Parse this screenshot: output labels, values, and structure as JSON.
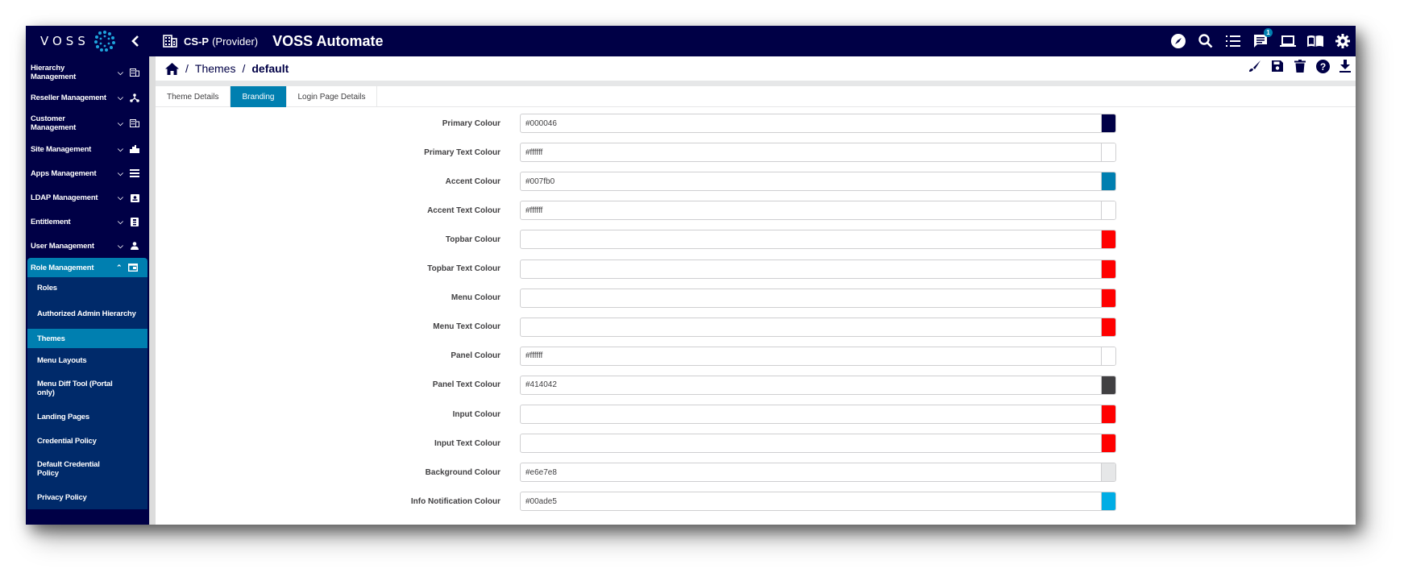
{
  "topbar": {
    "logo_text": "VOSS",
    "tenant_name": "CS-P",
    "tenant_role": "(Provider)",
    "app_title": "VOSS Automate",
    "notification_count": "1",
    "icons": [
      "compass-icon",
      "search-icon",
      "list-icon",
      "chat-icon",
      "laptop-icon",
      "book-icon",
      "gear-icon"
    ]
  },
  "sidebar": {
    "items": [
      {
        "label": "Hierarchy Management",
        "icon": "building-icon"
      },
      {
        "label": "Reseller Management",
        "icon": "hierarchy-icon"
      },
      {
        "label": "Customer Management",
        "icon": "building-icon"
      },
      {
        "label": "Site Management",
        "icon": "site-icon"
      },
      {
        "label": "Apps Management",
        "icon": "list-icon"
      },
      {
        "label": "LDAP Management",
        "icon": "contact-card-icon"
      },
      {
        "label": "Entitlement",
        "icon": "id-card-icon"
      },
      {
        "label": "User Management",
        "icon": "user-icon"
      },
      {
        "label": "Role Management",
        "icon": "window-icon"
      }
    ],
    "submenu": [
      {
        "label": "Roles"
      },
      {
        "label": "Authorized Admin Hierarchy"
      },
      {
        "label": "Themes"
      },
      {
        "label": "Menu Layouts"
      },
      {
        "label": "Menu Diff Tool (Portal only)"
      },
      {
        "label": "Landing Pages"
      },
      {
        "label": "Credential Policy"
      },
      {
        "label": "Default Credential Policy"
      },
      {
        "label": "Privacy Policy"
      }
    ]
  },
  "breadcrumb": {
    "section": "Themes",
    "current": "default"
  },
  "actions": [
    "brush-icon",
    "save-icon",
    "delete-icon",
    "help-icon",
    "download-icon"
  ],
  "tabs": [
    {
      "label": "Theme Details",
      "active": false
    },
    {
      "label": "Branding",
      "active": true
    },
    {
      "label": "Login Page Details",
      "active": false
    }
  ],
  "fields": [
    {
      "label": "Primary Colour",
      "value": "#000046",
      "swatch": "#000046"
    },
    {
      "label": "Primary Text Colour",
      "value": "#ffffff",
      "swatch": "#ffffff"
    },
    {
      "label": "Accent Colour",
      "value": "#007fb0",
      "swatch": "#007fb0"
    },
    {
      "label": "Accent Text Colour",
      "value": "#ffffff",
      "swatch": "#ffffff"
    },
    {
      "label": "Topbar Colour",
      "value": "",
      "swatch": "#ff0000"
    },
    {
      "label": "Topbar Text Colour",
      "value": "",
      "swatch": "#ff0000"
    },
    {
      "label": "Menu Colour",
      "value": "",
      "swatch": "#ff0000"
    },
    {
      "label": "Menu Text Colour",
      "value": "",
      "swatch": "#ff0000"
    },
    {
      "label": "Panel Colour",
      "value": "#ffffff",
      "swatch": "#ffffff"
    },
    {
      "label": "Panel Text Colour",
      "value": "#414042",
      "swatch": "#414042"
    },
    {
      "label": "Input Colour",
      "value": "",
      "swatch": "#ff0000"
    },
    {
      "label": "Input Text Colour",
      "value": "",
      "swatch": "#ff0000"
    },
    {
      "label": "Background Colour",
      "value": "#e6e7e8",
      "swatch": "#e6e7e8"
    },
    {
      "label": "Info Notification Colour",
      "value": "#00ade5",
      "swatch": "#00ade5"
    }
  ]
}
